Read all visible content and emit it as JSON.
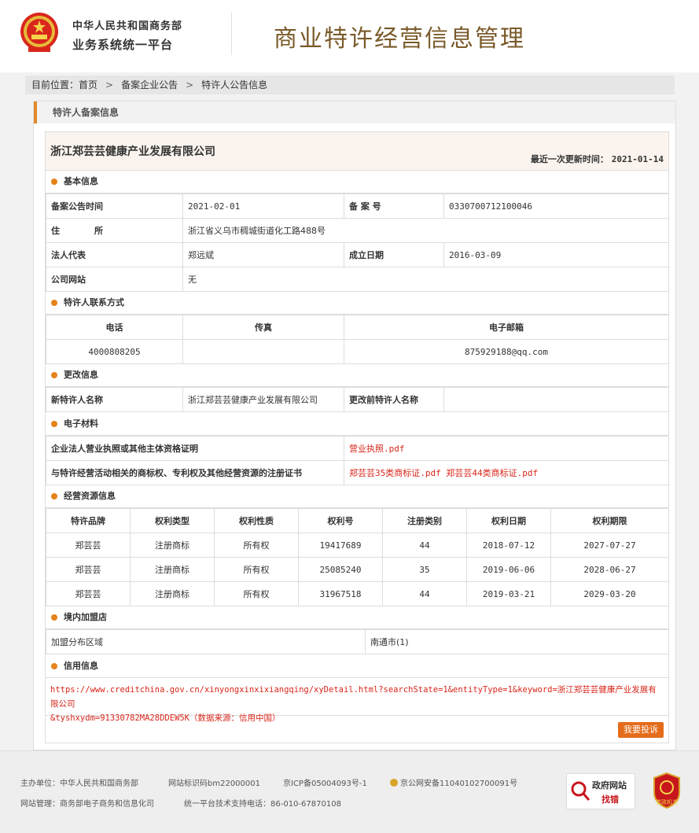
{
  "header": {
    "org_line1": "中华人民共和国商务部",
    "org_line2": "业务系统统一平台",
    "title": "商业特许经营信息管理"
  },
  "breadcrumb": {
    "prefix": "目前位置：",
    "items": [
      "首页",
      "备案企业公告",
      "特许人公告信息"
    ]
  },
  "panel": {
    "title": "特许人备案信息"
  },
  "company": {
    "name": "浙江郑芸芸健康产业发展有限公司",
    "update_label": "最近一次更新时间：",
    "update_date": "2021-01-14"
  },
  "basic": {
    "title": "基本信息",
    "announce_time_label": "备案公告时间",
    "announce_time": "2021-02-01",
    "filing_no_label": "备 案 号",
    "filing_no": "0330700712100046",
    "address_label": "住　　　　所",
    "address": "浙江省义乌市稠城街道化工路488号",
    "legal_rep_label": "法人代表",
    "legal_rep": "郑远斌",
    "founded_label": "成立日期",
    "founded": "2016-03-09",
    "website_label": "公司网站",
    "website": "无"
  },
  "contact": {
    "title": "特许人联系方式",
    "headers": [
      "电话",
      "传真",
      "电子邮箱"
    ],
    "phone": "4000808205",
    "fax": "",
    "email": "875929188@qq.com"
  },
  "change": {
    "title": "更改信息",
    "new_name_label": "新特许人名称",
    "new_name": "浙江郑芸芸健康产业发展有限公司",
    "old_name_label": "更改前特许人名称",
    "old_name": ""
  },
  "materials": {
    "title": "电子材料",
    "row1_label": "企业法人营业执照或其他主体资格证明",
    "row1_file": "营业执照.pdf",
    "row2_label": "与特许经营活动相关的商标权、专利权及其他经营资源的注册证书",
    "row2_file1": "郑芸芸35类商标证.pdf",
    "row2_file2": "郑芸芸44类商标证.pdf"
  },
  "resources": {
    "title": "经营资源信息",
    "headers": [
      "特许品牌",
      "权利类型",
      "权利性质",
      "权利号",
      "注册类别",
      "权利日期",
      "权利期限"
    ],
    "rows": [
      [
        "郑芸芸",
        "注册商标",
        "所有权",
        "19417689",
        "44",
        "2018-07-12",
        "2027-07-27"
      ],
      [
        "郑芸芸",
        "注册商标",
        "所有权",
        "25085240",
        "35",
        "2019-06-06",
        "2028-06-27"
      ],
      [
        "郑芸芸",
        "注册商标",
        "所有权",
        "31967518",
        "44",
        "2019-03-21",
        "2029-03-20"
      ]
    ]
  },
  "domestic": {
    "title": "境内加盟店",
    "region_label": "加盟分布区域",
    "region_value": "南通市(1)"
  },
  "credit": {
    "title": "信用信息",
    "line1": "https://www.creditchina.gov.cn/xinyongxinxixiangqing/xyDetail.html?searchState=1&entityType=1&keyword=浙江郑芸芸健康产业发展有限公司",
    "line2": "&tyshxydm=91330782MA28DDEW5K（数据来源：信用中国）",
    "complain_label": "我要投诉"
  },
  "footer": {
    "host": "主办单位：中华人民共和国商务部",
    "site_code": "网站标识码bm22000001",
    "icp": "京ICP备05004093号-1",
    "police": "京公网安备11040102700091号",
    "manager": "网站管理：商务部电子商务和信息化司",
    "support": "统一平台技术支持电话：86-010-67870108",
    "find_error_line1": "政府网站",
    "find_error_line2": "找错",
    "badge_text": "党政机关"
  },
  "colors": {
    "accent": "#e5821a",
    "title_brown": "#7a5a2a",
    "link_red": "#d8261b"
  }
}
